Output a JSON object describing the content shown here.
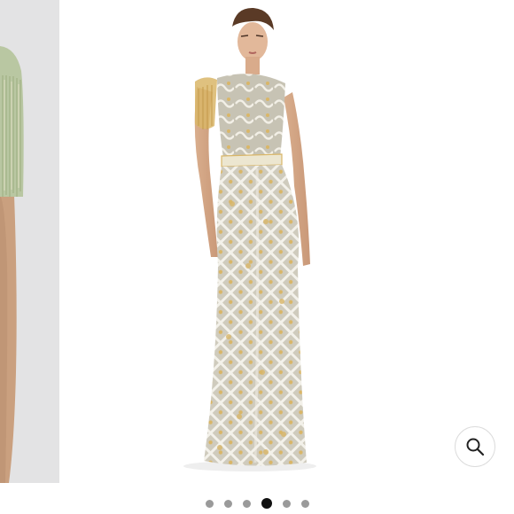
{
  "gallery": {
    "current_index": 3,
    "slide_count": 6,
    "slides": [
      {
        "name": "previous-slide-photo"
      },
      {
        "name": "current-slide-photo"
      }
    ],
    "zoom_icon": "magnifying-glass-icon"
  },
  "colors": {
    "gown": "#c9c4b3",
    "gold_sequins": "#d9b668",
    "fringe_preview": "#b9c7a2",
    "active_dot": "#111111",
    "inactive_dot": "#9a9a9a"
  }
}
